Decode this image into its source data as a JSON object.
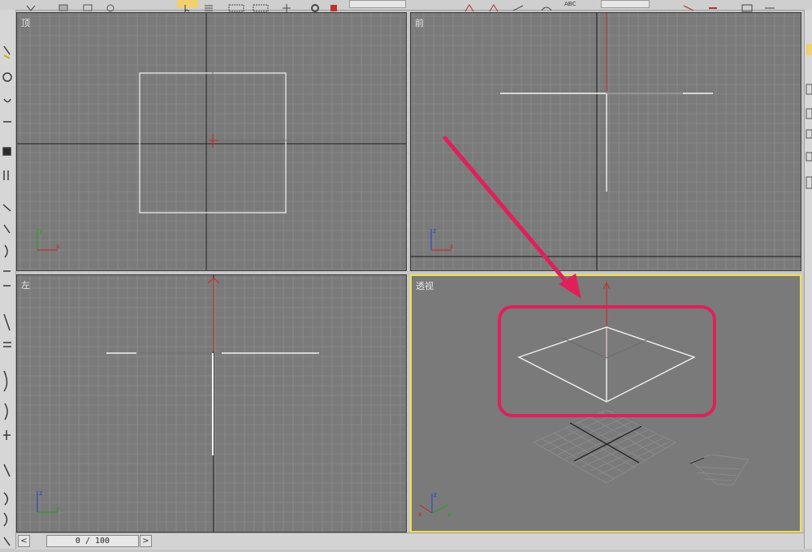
{
  "viewports": {
    "top": {
      "label": "顶"
    },
    "front": {
      "label": "前"
    },
    "left": {
      "label": "左"
    },
    "perspective": {
      "label": "透视"
    }
  },
  "timeline": {
    "value": "0 / 100",
    "prev": "<",
    "next": ">"
  },
  "toolbar": {
    "abc_label": "ABC"
  },
  "axes": {
    "x": "x",
    "y": "y",
    "z": "z"
  },
  "colors": {
    "viewport_bg": "#7a7a7a",
    "grid": "#8d8d8d",
    "active_border": "#f2e14a",
    "annotation": "#e0205a"
  },
  "icons": [
    "select-icon",
    "move-icon",
    "rotate-icon",
    "scale-icon",
    "camera-icon",
    "spacewarp-icon"
  ]
}
